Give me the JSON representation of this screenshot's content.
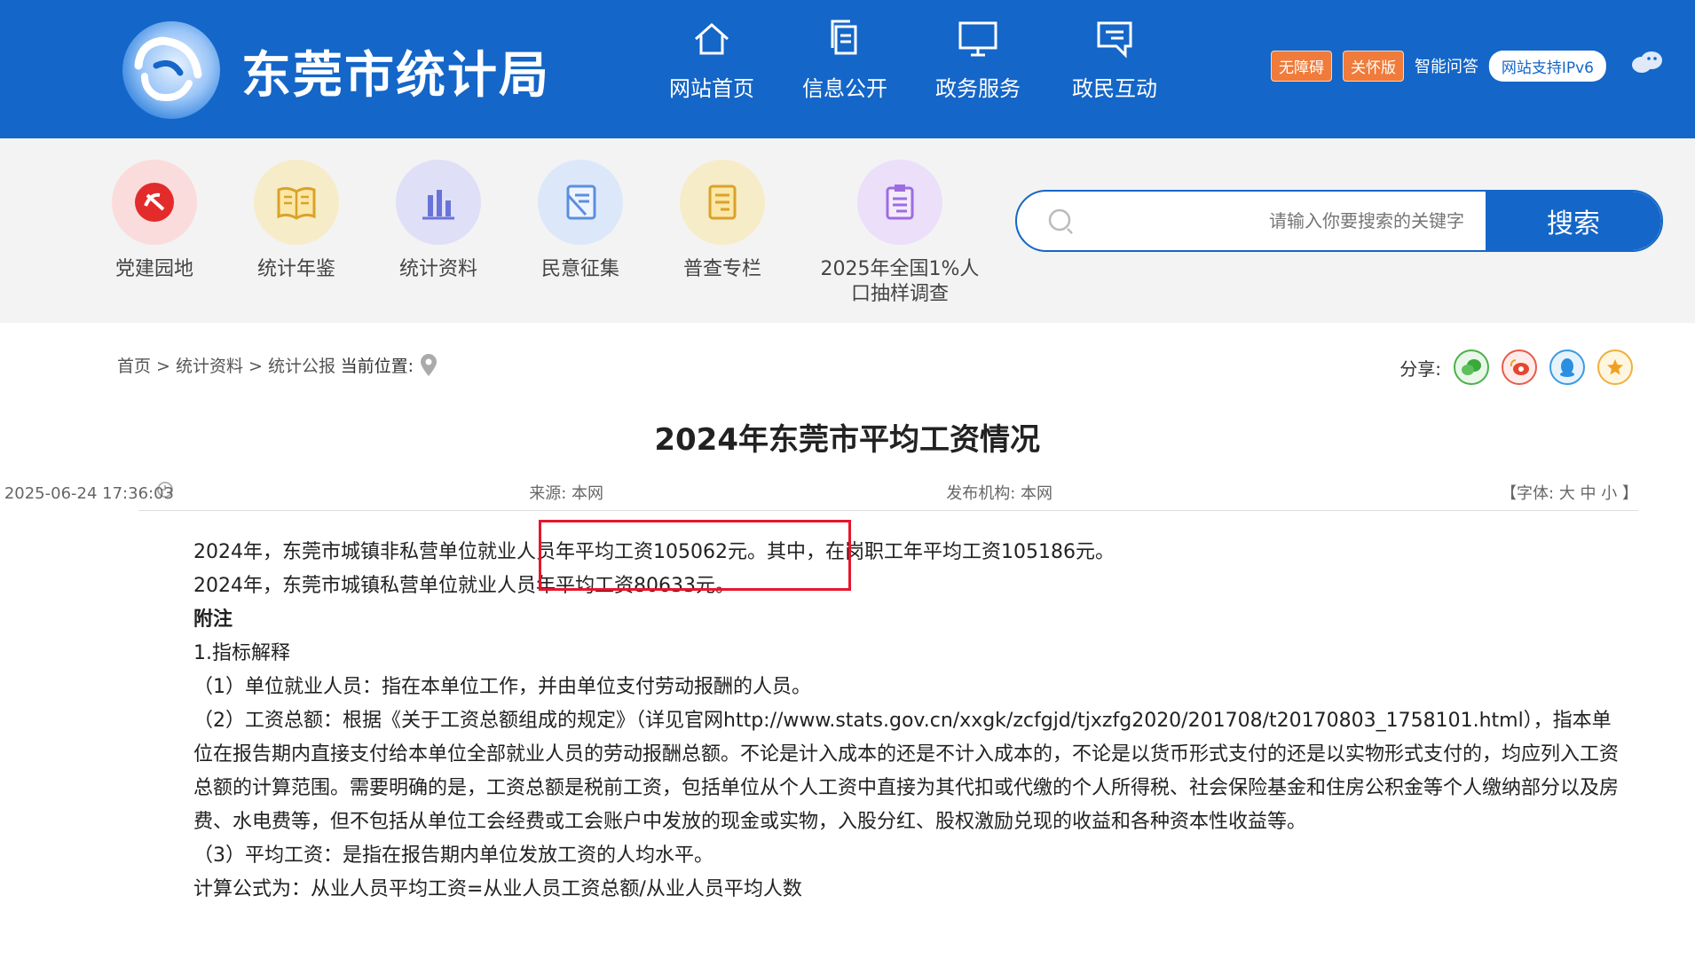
{
  "header": {
    "site_title": "东莞市统计局",
    "nav": [
      {
        "label": "网站首页",
        "icon": "home-icon"
      },
      {
        "label": "信息公开",
        "icon": "document-icon"
      },
      {
        "label": "政务服务",
        "icon": "monitor-icon"
      },
      {
        "label": "政民互动",
        "icon": "chat-icon"
      }
    ],
    "util": {
      "barrier_free": "无障碍",
      "care_edition": "关怀版",
      "smart_qa": "智能问答",
      "ipv6": "网站支持IPv6"
    }
  },
  "quick_nav": [
    {
      "label": "党建园地",
      "icon": "party-emblem-icon",
      "color": "#e84a4a"
    },
    {
      "label": "统计年鉴",
      "icon": "book-icon",
      "color": "#e8b13a"
    },
    {
      "label": "统计资料",
      "icon": "bar-chart-icon",
      "color": "#6a73d8"
    },
    {
      "label": "民意征集",
      "icon": "edit-icon",
      "color": "#5a8fe0"
    },
    {
      "label": "普查专栏",
      "icon": "scroll-icon",
      "color": "#e0a83a"
    },
    {
      "label": "2025年全国1%人口抽样调查",
      "icon": "clipboard-icon",
      "color": "#9c6ce0"
    }
  ],
  "search": {
    "button": "搜索",
    "placeholder": "请输入你要搜索的关键字"
  },
  "breadcrumb": {
    "prefix": "当前位置:",
    "path": "首页 > 统计资料 > 统计公报"
  },
  "share": {
    "label": "分享:"
  },
  "article": {
    "title": "2024年东莞市平均工资情况",
    "date": "2025-06-24 17:36:03",
    "source": "来源: 本网",
    "publisher": "发布机构: 本网",
    "font_size": "【字体: 大 中 小 】",
    "paragraphs": [
      "2024年，东莞市城镇非私营单位就业人员年平均工资105062元。其中，在岗职工年平均工资105186元。",
      "2024年，东莞市城镇私营单位就业人员年平均工资80633元。"
    ],
    "note_title": "附注",
    "notes": [
      "1.指标解释",
      "（1）单位就业人员：指在本单位工作，并由单位支付劳动报酬的人员。",
      "（2）工资总额：根据《关于工资总额组成的规定》（详见官网http://www.stats.gov.cn/xxgk/zcfgjd/tjxzfg2020/201708/t20170803_1758101.html），指本单位在报告期内直接支付给本单位全部就业人员的劳动报酬总额。不论是计入成本的还是不计入成本的，不论是以货币形式支付的还是以实物形式支付的，均应列入工资总额的计算范围。需要明确的是，工资总额是税前工资，包括单位从个人工资中直接为其代扣或代缴的个人所得税、社会保险基金和住房公积金等个人缴纳部分以及房费、水电费等，但不包括从单位工会经费或工会账户中发放的现金或实物，入股分红、股权激励兑现的收益和各种资本性收益等。",
      "（3）平均工资：是指在报告期内单位发放工资的人均水平。",
      "计算公式为：从业人员平均工资=从业人员工资总额/从业人员平均人数"
    ]
  }
}
